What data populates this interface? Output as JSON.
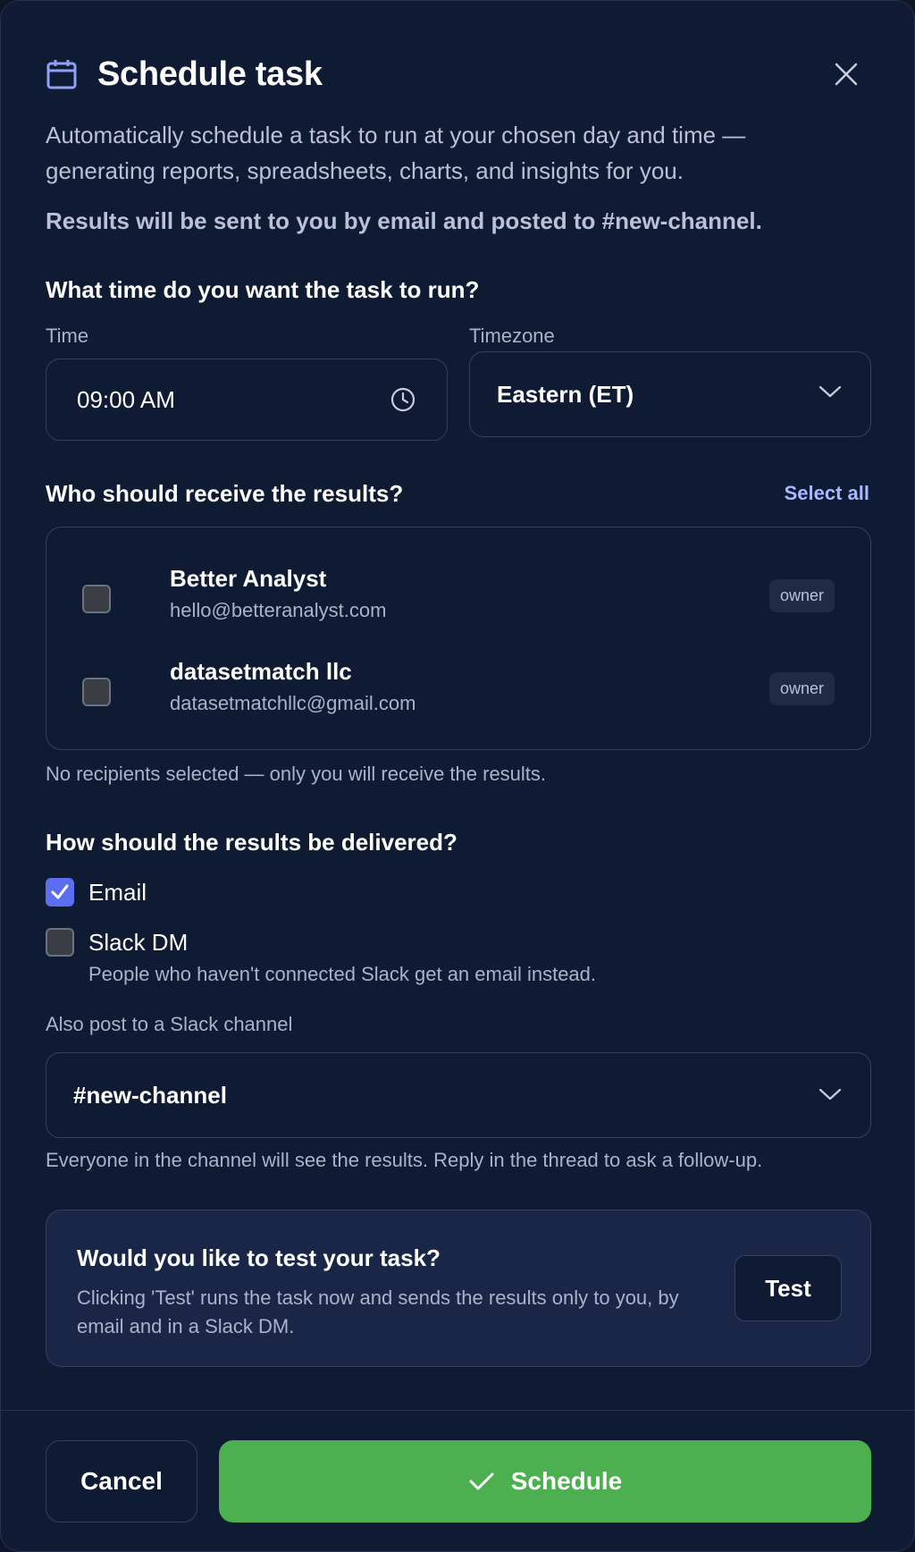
{
  "dialog": {
    "title": "Schedule task",
    "icon": "calendar-icon",
    "description": "Automatically schedule a task to run at your chosen day and time — generating reports, spreadsheets, charts, and insights for you.",
    "results_note": "Results will be sent to you by email and posted to #new-channel."
  },
  "time_section": {
    "title": "What time do you want the task to run?",
    "time_label": "Time",
    "time_value": "09:00 AM",
    "timezone_label": "Timezone",
    "timezone_value": "Eastern (ET)"
  },
  "recipients": {
    "title": "Who should receive the results?",
    "select_all_label": "Select all",
    "items": [
      {
        "name": "Better Analyst",
        "email": "hello@betteranalyst.com",
        "role": "owner",
        "checked": false
      },
      {
        "name": "datasetmatch llc",
        "email": "datasetmatchllc@gmail.com",
        "role": "owner",
        "checked": false
      }
    ],
    "hint": "No recipients selected — only you will receive the results."
  },
  "delivery": {
    "title": "How should the results be delivered?",
    "email_label": "Email",
    "email_checked": true,
    "slack_dm_label": "Slack DM",
    "slack_dm_checked": false,
    "slack_dm_hint": "People who haven't connected Slack get an email instead.",
    "channel_label": "Also post to a Slack channel",
    "channel_value": "#new-channel",
    "channel_hint": "Everyone in the channel will see the results. Reply in the thread to ask a follow-up."
  },
  "test": {
    "title": "Would you like to test your task?",
    "description": "Clicking 'Test' runs the task now and sends the results only to you, by email and in a Slack DM.",
    "button_label": "Test"
  },
  "footer": {
    "cancel_label": "Cancel",
    "schedule_label": "Schedule"
  },
  "colors": {
    "background": "#0f1a33",
    "accent": "#5b6ef0",
    "link": "#a9b8ff",
    "primary_button": "#4caf50"
  }
}
